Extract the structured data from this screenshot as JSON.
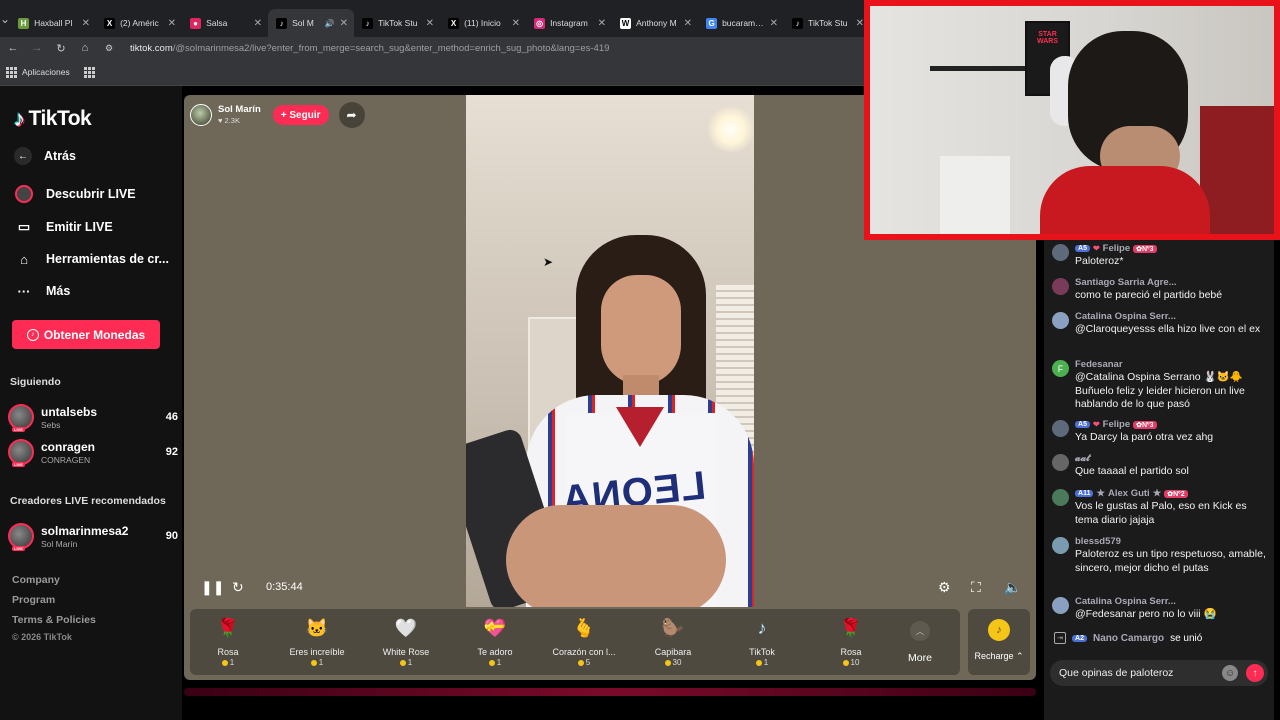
{
  "browser": {
    "tabs": [
      {
        "title": "Haxball Pl",
        "icon_color": "#6a9a3a",
        "icon_char": "H",
        "active": false
      },
      {
        "title": "(2) Améric",
        "icon_color": "#000000",
        "icon_char": "X",
        "active": false
      },
      {
        "title": "Salsa",
        "icon_color": "#e0245e",
        "icon_char": "●",
        "active": false
      },
      {
        "title": "Sol M",
        "icon_color": "#000000",
        "icon_char": "♪",
        "active": true
      },
      {
        "title": "TikTok Stu",
        "icon_color": "#000000",
        "icon_char": "♪",
        "active": false
      },
      {
        "title": "(11) Inicio",
        "icon_color": "#000000",
        "icon_char": "X",
        "active": false
      },
      {
        "title": "Instagram",
        "icon_color": "#d62976",
        "icon_char": "◎",
        "active": false
      },
      {
        "title": "Anthony M",
        "icon_color": "#ffffff",
        "icon_char": "W",
        "active": false
      },
      {
        "title": "bucaramang",
        "icon_color": "#4285f4",
        "icon_char": "G",
        "active": false
      },
      {
        "title": "TikTok Stu",
        "icon_color": "#000000",
        "icon_char": "♪",
        "active": false
      }
    ],
    "url_domain": "tiktok.com",
    "url_path": "/@solmarinmesa2/live?enter_from_merge=search_sug&enter_method=enrich_sug_photo&lang=es-419",
    "bookmarks_label": "Aplicaciones"
  },
  "sidebar": {
    "logo_text": "TikTok",
    "back_label": "Atrás",
    "nav": [
      {
        "label": "Descubrir LIVE",
        "icon": "live-avatar-icon"
      },
      {
        "label": "Emitir LIVE",
        "icon": "camera-icon"
      },
      {
        "label": "Herramientas de cr...",
        "icon": "home-tools-icon"
      },
      {
        "label": "Más",
        "icon": "more-dots-icon"
      }
    ],
    "coins_button": "Obtener Monedas",
    "following_title": "Siguiendo",
    "following": [
      {
        "name": "untalsebs",
        "sub": "Sebs",
        "count": "46"
      },
      {
        "name": "conragen",
        "sub": "CONRAGEN",
        "count": "92"
      }
    ],
    "recommended_title": "Creadores LIVE recomendados",
    "recommended": [
      {
        "name": "solmarinmesa2",
        "sub": "Sol Marín",
        "count": "90"
      }
    ],
    "footer": [
      "Company",
      "Program",
      "Terms & Policies"
    ],
    "copyright": "© 2026 TikTok"
  },
  "live": {
    "host_name": "Sol Marín",
    "host_likes": "♥ 2.3K",
    "follow_label": "+ Seguir",
    "elapsed": "0:35:44",
    "shirt_text": "LEONA",
    "gifts": [
      {
        "name": "Rosa",
        "price": "1",
        "emoji": "🌹"
      },
      {
        "name": "Eres increíble",
        "price": "1",
        "emoji": "🐱"
      },
      {
        "name": "White Rose",
        "price": "1",
        "emoji": "🤍"
      },
      {
        "name": "Te adoro",
        "price": "1",
        "emoji": "💝"
      },
      {
        "name": "Corazón con l...",
        "price": "5",
        "emoji": "🫰"
      },
      {
        "name": "Capibara",
        "price": "30",
        "emoji": "🦫"
      },
      {
        "name": "TikTok",
        "price": "1",
        "emoji": "♪"
      },
      {
        "name": "Rosa",
        "price": "10",
        "emoji": "🌹"
      }
    ],
    "more_label": "More",
    "recharge_label": "Recharge ⌃"
  },
  "webcam": {
    "poster_text": "STAR WARS"
  },
  "chat": {
    "messages": [
      {
        "user": "Felipe",
        "level": "5",
        "fan": "Nº3",
        "heart": true,
        "text": "Paloteroz*",
        "av": "#5c6a7a"
      },
      {
        "user": "Santiago Sarria Agre...",
        "text": "como te pareció el partido bebé",
        "av": "#7a3a5a"
      },
      {
        "user": "Catalina Ospina Serr...",
        "text": "@Claroqueyesss ella hizo live con el ex",
        "av": "#8aa0c0"
      },
      {
        "user": "Fedesanar",
        "text": "@Catalina Ospina Serrano 🐰🐱🐥 Buñuelo feliz y leider hicieron un live hablando de lo que pasó",
        "av": "#4caf50",
        "initial": "F"
      },
      {
        "user": "Felipe",
        "level": "5",
        "fan": "Nº3",
        "heart": true,
        "text": "Ya Darcy la paró otra vez ahg",
        "av": "#5c6a7a"
      },
      {
        "user": "𝓪𝓪𝓽",
        "text": "Que taaaal el partido sol",
        "av": "#666666"
      },
      {
        "user": "Alex Guti",
        "level": "11",
        "fan": "Nº2",
        "star": true,
        "text": "Vos le gustas al Palo, eso en Kick es tema diario jajaja",
        "av": "#4a7a5a"
      },
      {
        "user": "blessd579",
        "text": "Paloteroz es un tipo respetuoso, amable, sincero, mejor dicho el putas",
        "av": "#7a9ab0"
      },
      {
        "user": "Catalina Ospina Serr...",
        "text": "@Fedesanar pero no lo viii 😭",
        "av": "#8aa0c0"
      }
    ],
    "join": {
      "level": "2",
      "user": "Nano Camargo",
      "action": "se unió"
    },
    "input_value": "Que opinas de paloteroz"
  }
}
